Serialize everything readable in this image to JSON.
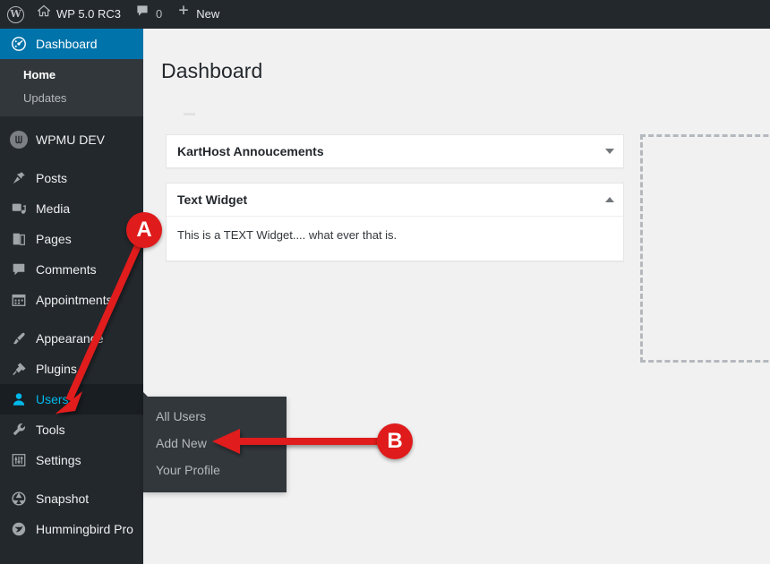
{
  "adminbar": {
    "wp_logo_icon": "wordpress-logo-icon",
    "site_name": "WP 5.0 RC3",
    "site_icon": "home-icon",
    "comments_icon": "comment-bubble-icon",
    "comments_count": "0",
    "new_icon": "plus-icon",
    "new_label": "New"
  },
  "sidebar": {
    "items": [
      {
        "label": "Dashboard",
        "icon": "dashboard-gauge-icon",
        "state": "current"
      },
      {
        "label": "WPMU DEV",
        "icon": "wpmu-dev-icon",
        "state": "normal"
      },
      {
        "label": "Posts",
        "icon": "pushpin-icon",
        "state": "normal"
      },
      {
        "label": "Media",
        "icon": "media-photo-music-icon",
        "state": "normal"
      },
      {
        "label": "Pages",
        "icon": "pages-document-icon",
        "state": "normal"
      },
      {
        "label": "Comments",
        "icon": "comment-bubble-icon",
        "state": "normal"
      },
      {
        "label": "Appointments",
        "icon": "calendar-icon",
        "state": "normal"
      },
      {
        "label": "Appearance",
        "icon": "paintbrush-icon",
        "state": "normal"
      },
      {
        "label": "Plugins",
        "icon": "plug-icon",
        "state": "normal"
      },
      {
        "label": "Users",
        "icon": "user-silhouette-icon",
        "state": "hovered"
      },
      {
        "label": "Tools",
        "icon": "wrench-icon",
        "state": "normal"
      },
      {
        "label": "Settings",
        "icon": "sliders-icon",
        "state": "normal"
      },
      {
        "label": "Snapshot",
        "icon": "camera-aperture-icon",
        "state": "normal"
      },
      {
        "label": "Hummingbird Pro",
        "icon": "hummingbird-icon",
        "state": "normal"
      }
    ],
    "dashboard_submenu": [
      {
        "label": "Home",
        "current": true
      },
      {
        "label": "Updates",
        "current": false
      }
    ],
    "users_flyout": [
      {
        "label": "All Users"
      },
      {
        "label": "Add New"
      },
      {
        "label": "Your Profile"
      }
    ]
  },
  "content": {
    "page_title": "Dashboard",
    "widgets": [
      {
        "title": "KartHost Annoucements",
        "toggle_icon": "chevron-down-icon",
        "expanded": false,
        "body": ""
      },
      {
        "title": "Text Widget",
        "toggle_icon": "chevron-up-icon",
        "expanded": true,
        "body": "This is a TEXT Widget.... what ever that is."
      }
    ],
    "dropzone_label": ""
  },
  "annotations": [
    {
      "id": "A",
      "label": "A",
      "points_to": "sidebar-item-users"
    },
    {
      "id": "B",
      "label": "B",
      "points_to": "users-flyout-add-new"
    }
  ],
  "colors": {
    "admin_dark": "#23282d",
    "submenu_dark": "#32373c",
    "accent_blue": "#0073aa",
    "hover_blue": "#00b9eb",
    "annotation_red": "#e01b1b",
    "page_bg": "#f1f1f1"
  }
}
